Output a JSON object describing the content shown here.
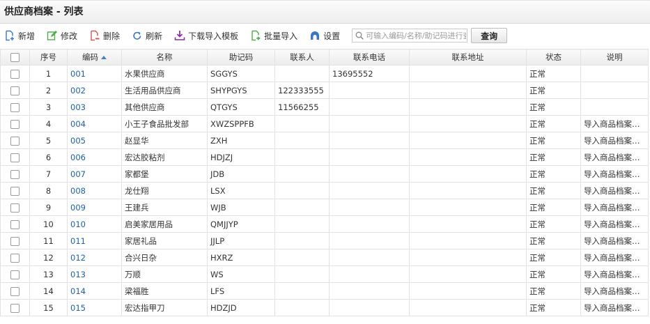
{
  "page_title": "供应商档案 - 列表",
  "toolbar": {
    "add": "新增",
    "edit": "修改",
    "delete": "删除",
    "refresh": "刷新",
    "download_template": "下载导入模板",
    "batch_import": "批量导入",
    "settings": "设置",
    "search_placeholder": "可输入编码/名称/助记码进行查询",
    "query": "查询"
  },
  "icons": {
    "add": "new-document-icon",
    "edit": "edit-icon",
    "delete": "delete-icon",
    "refresh": "refresh-icon",
    "download": "download-icon",
    "import": "import-icon",
    "settings": "settings-icon",
    "search": "search-icon"
  },
  "colors": {
    "add": "#3a78c3",
    "edit": "#4cae4c",
    "delete": "#d9534f",
    "refresh": "#3a78c3",
    "download": "#8a2fa0",
    "import": "#4cae4c",
    "settings": "#3a78c3",
    "code_link": "#1d5fa6"
  },
  "table": {
    "headers": {
      "seq": "序号",
      "code": "编码",
      "name": "名称",
      "mnemonic": "助记码",
      "contact": "联系人",
      "phone": "联系电话",
      "address": "联系地址",
      "status": "状态",
      "remark": "说明"
    },
    "sort_column": "code",
    "sort_direction": "asc",
    "rows": [
      {
        "seq": "1",
        "code": "001",
        "name": "水果供应商",
        "mnemonic": "SGGYS",
        "contact": "",
        "phone": "13695552",
        "address": "",
        "status": "正常",
        "remark": ""
      },
      {
        "seq": "2",
        "code": "002",
        "name": "生活用品供应商",
        "mnemonic": "SHYPGYS",
        "contact": "122333555",
        "phone": "",
        "address": "",
        "status": "正常",
        "remark": ""
      },
      {
        "seq": "3",
        "code": "003",
        "name": "其他供应商",
        "mnemonic": "QTGYS",
        "contact": "11566255",
        "phone": "",
        "address": "",
        "status": "正常",
        "remark": ""
      },
      {
        "seq": "4",
        "code": "004",
        "name": "小王子食品批发部",
        "mnemonic": "XWZSPPFB",
        "contact": "",
        "phone": "",
        "address": "",
        "status": "正常",
        "remark": "导入商品档案时..."
      },
      {
        "seq": "5",
        "code": "005",
        "name": "赵显华",
        "mnemonic": "ZXH",
        "contact": "",
        "phone": "",
        "address": "",
        "status": "正常",
        "remark": "导入商品档案时..."
      },
      {
        "seq": "6",
        "code": "006",
        "name": "宏达胶粘剂",
        "mnemonic": "HDJZJ",
        "contact": "",
        "phone": "",
        "address": "",
        "status": "正常",
        "remark": "导入商品档案时..."
      },
      {
        "seq": "7",
        "code": "007",
        "name": "家都堡",
        "mnemonic": "JDB",
        "contact": "",
        "phone": "",
        "address": "",
        "status": "正常",
        "remark": "导入商品档案时..."
      },
      {
        "seq": "8",
        "code": "008",
        "name": "龙仕翔",
        "mnemonic": "LSX",
        "contact": "",
        "phone": "",
        "address": "",
        "status": "正常",
        "remark": "导入商品档案时..."
      },
      {
        "seq": "9",
        "code": "009",
        "name": "王建兵",
        "mnemonic": "WJB",
        "contact": "",
        "phone": "",
        "address": "",
        "status": "正常",
        "remark": "导入商品档案时..."
      },
      {
        "seq": "10",
        "code": "010",
        "name": "启美家居用品",
        "mnemonic": "QMJJYP",
        "contact": "",
        "phone": "",
        "address": "",
        "status": "正常",
        "remark": "导入商品档案时..."
      },
      {
        "seq": "11",
        "code": "011",
        "name": "家居礼品",
        "mnemonic": "JJLP",
        "contact": "",
        "phone": "",
        "address": "",
        "status": "正常",
        "remark": "导入商品档案时..."
      },
      {
        "seq": "12",
        "code": "012",
        "name": "合兴日杂",
        "mnemonic": "HXRZ",
        "contact": "",
        "phone": "",
        "address": "",
        "status": "正常",
        "remark": "导入商品档案时..."
      },
      {
        "seq": "13",
        "code": "013",
        "name": "万顺",
        "mnemonic": "WS",
        "contact": "",
        "phone": "",
        "address": "",
        "status": "正常",
        "remark": "导入商品档案时..."
      },
      {
        "seq": "14",
        "code": "014",
        "name": "梁福胜",
        "mnemonic": "LFS",
        "contact": "",
        "phone": "",
        "address": "",
        "status": "正常",
        "remark": "导入商品档案时..."
      },
      {
        "seq": "15",
        "code": "015",
        "name": "宏达指甲刀",
        "mnemonic": "HDZJD",
        "contact": "",
        "phone": "",
        "address": "",
        "status": "正常",
        "remark": "导入商品档案时..."
      }
    ]
  }
}
